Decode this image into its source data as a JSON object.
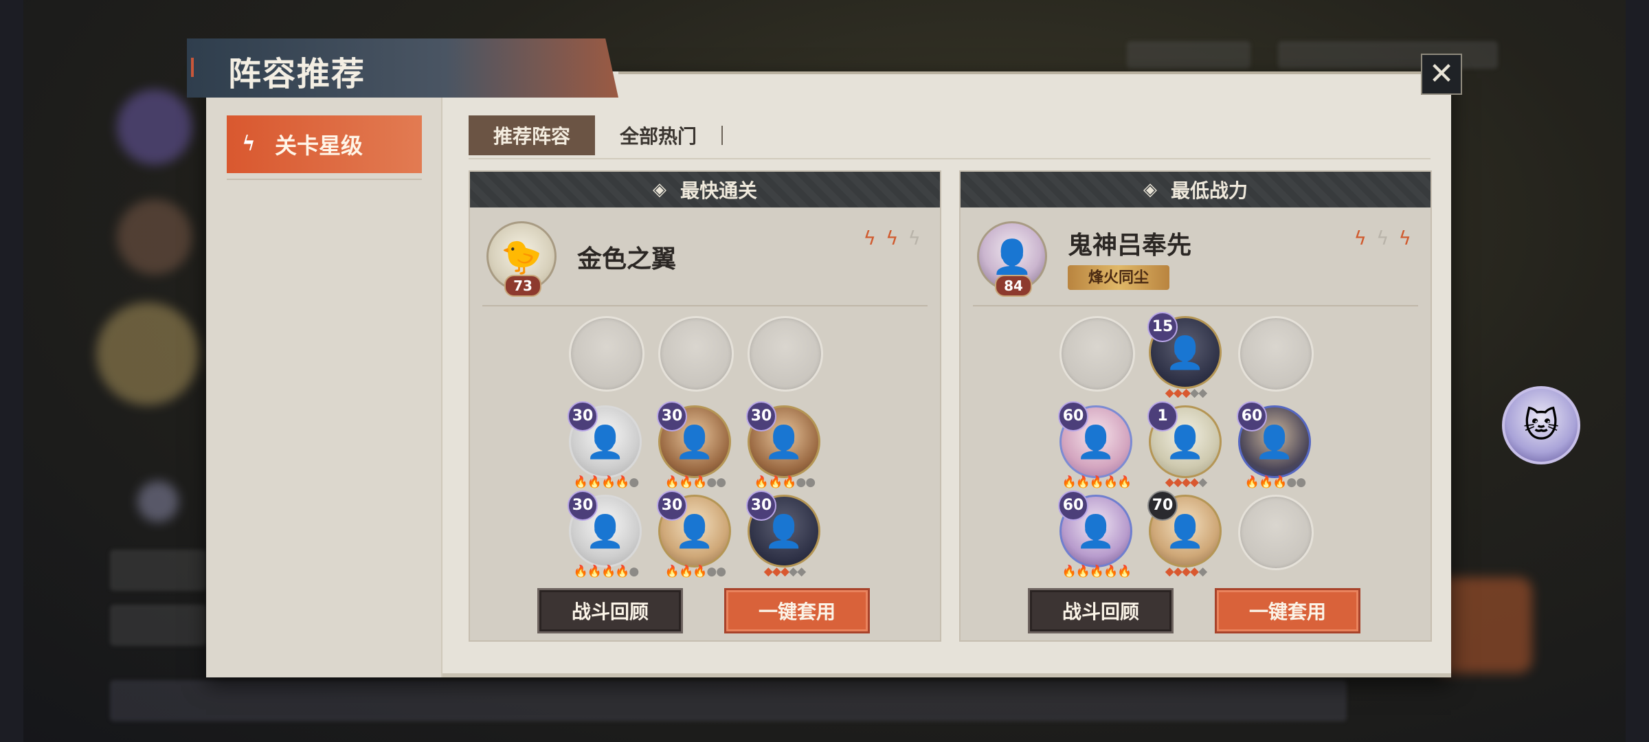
{
  "window": {
    "title": "阵容推荐"
  },
  "sidebar": {
    "items": [
      {
        "label": "关卡星级",
        "icon": "stage-star-icon"
      }
    ]
  },
  "tabs": [
    {
      "label": "推荐阵容",
      "active": true
    },
    {
      "label": "全部热门",
      "active": false
    }
  ],
  "cards": [
    {
      "header": "最快通关",
      "leader": {
        "level": "73",
        "glyph": "🐤"
      },
      "team_name": "金色之翼",
      "team_tag": "",
      "stars": [
        true,
        true,
        false
      ],
      "rows": [
        [
          {
            "empty": true
          },
          {
            "empty": true
          },
          {
            "empty": true
          }
        ],
        [
          {
            "level": "30",
            "style": "gray",
            "glyph": "👤",
            "pips": "🔥🔥🔥🔥●"
          },
          {
            "level": "30",
            "style": "warm",
            "glyph": "👤",
            "pips": "🔥🔥🔥●●"
          },
          {
            "level": "30",
            "style": "warm",
            "glyph": "👤",
            "pips": "🔥🔥🔥●●"
          }
        ],
        [
          {
            "level": "30",
            "style": "gray",
            "glyph": "👤",
            "pips": "🔥🔥🔥🔥●"
          },
          {
            "level": "30",
            "style": "blond",
            "glyph": "👤",
            "pips": "🔥🔥🔥●●"
          },
          {
            "level": "30",
            "style": "dark",
            "glyph": "👤",
            "pips": "◆◆◆◇◇"
          }
        ]
      ],
      "buttons": {
        "review": "战斗回顾",
        "apply": "一键套用"
      }
    },
    {
      "header": "最低战力",
      "leader": {
        "level": "84",
        "glyph": "👤"
      },
      "team_name": "鬼神吕奉先",
      "team_tag": "烽火同尘",
      "stars": [
        true,
        false,
        true
      ],
      "rows": [
        [
          {
            "empty": true
          },
          {
            "level": "15",
            "style": "dark",
            "glyph": "👤",
            "pips": "◆◆◆◇◇"
          },
          {
            "empty": true
          }
        ],
        [
          {
            "level": "60",
            "style": "pink",
            "glyph": "👤",
            "pips": "🔥🔥🔥🔥🔥"
          },
          {
            "level": "1",
            "style": "pale",
            "glyph": "👤",
            "pips": "◆◆◆◆◇"
          },
          {
            "level": "60",
            "style": "blue",
            "glyph": "👤",
            "pips": "🔥🔥🔥●●"
          }
        ],
        [
          {
            "level": "60",
            "style": "lav",
            "glyph": "👤",
            "pips": "🔥🔥🔥🔥🔥"
          },
          {
            "level": "70",
            "style": "blond",
            "glyph": "👤",
            "pips": "◆◆◆◆◇",
            "dark_level": true
          },
          {
            "empty": true
          }
        ]
      ],
      "buttons": {
        "review": "战斗回顾",
        "apply": "一键套用"
      }
    }
  ]
}
